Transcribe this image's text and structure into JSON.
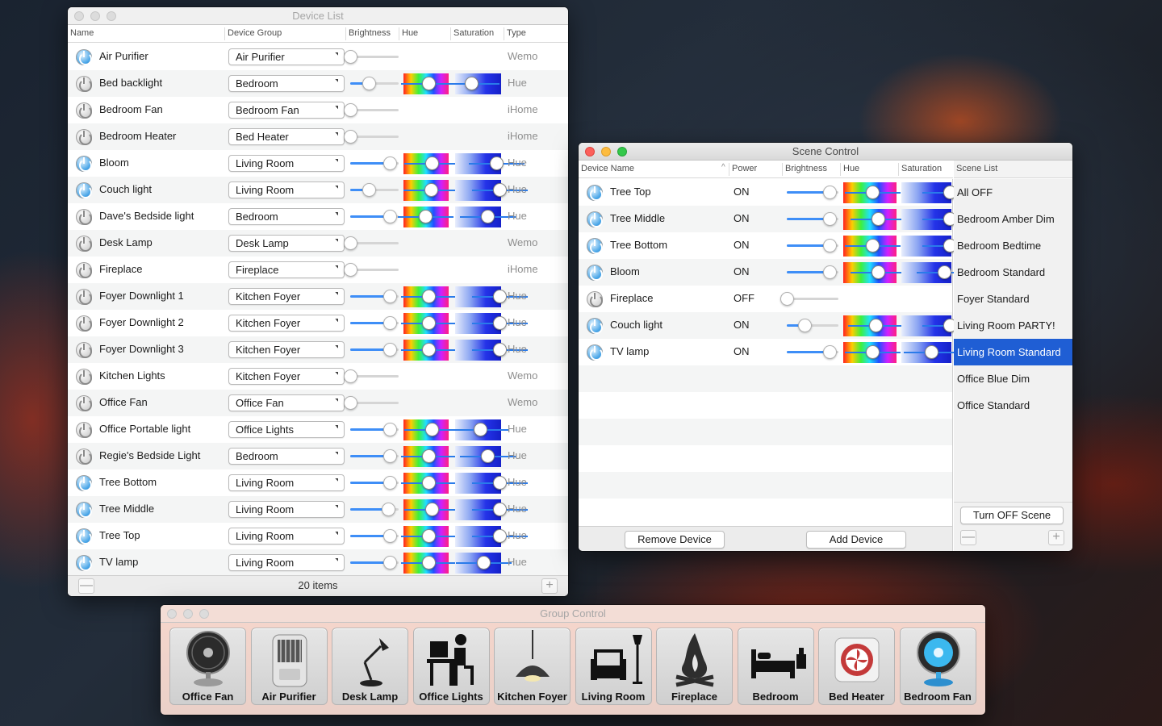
{
  "device_list": {
    "title": "Device List",
    "columns": {
      "name": "Name",
      "group": "Device Group",
      "brightness": "Brightness",
      "hue": "Hue",
      "saturation": "Saturation",
      "type": "Type"
    },
    "footer_count": "20 items",
    "remove_symbol": "—",
    "add_symbol": "+",
    "rows": [
      {
        "name": "Air Purifier",
        "group": "Air Purifier",
        "type": "Wemo",
        "on": true,
        "brightness": 0,
        "hue": null,
        "sat": null
      },
      {
        "name": "Bed backlight",
        "group": "Bedroom",
        "type": "Hue",
        "on": false,
        "brightness": 0.45,
        "hue": 0.55,
        "sat": 0.35
      },
      {
        "name": "Bedroom Fan",
        "group": "Bedroom Fan",
        "type": "iHome",
        "on": false,
        "brightness": 0,
        "hue": null,
        "sat": null
      },
      {
        "name": "Bedroom Heater",
        "group": "Bed Heater",
        "type": "iHome",
        "on": false,
        "brightness": 0,
        "hue": null,
        "sat": null
      },
      {
        "name": "Bloom",
        "group": "Living Room",
        "type": "Hue",
        "on": true,
        "brightness": 0.95,
        "hue": 0.62,
        "sat": 0.9
      },
      {
        "name": "Couch light",
        "group": "Living Room",
        "type": "Hue",
        "on": true,
        "brightness": 0.45,
        "hue": 0.6,
        "sat": 0.97
      },
      {
        "name": "Dave's Bedside light",
        "group": "Bedroom",
        "type": "Hue",
        "on": false,
        "brightness": 0.95,
        "hue": 0.48,
        "sat": 0.7
      },
      {
        "name": "Desk Lamp",
        "group": "Desk Lamp",
        "type": "Wemo",
        "on": false,
        "brightness": 0,
        "hue": null,
        "sat": null
      },
      {
        "name": "Fireplace",
        "group": "Fireplace",
        "type": "iHome",
        "on": false,
        "brightness": 0,
        "hue": null,
        "sat": null
      },
      {
        "name": "Foyer Downlight 1",
        "group": "Kitchen Foyer",
        "type": "Hue",
        "on": false,
        "brightness": 0.95,
        "hue": 0.55,
        "sat": 0.97
      },
      {
        "name": "Foyer Downlight 2",
        "group": "Kitchen Foyer",
        "type": "Hue",
        "on": false,
        "brightness": 0.95,
        "hue": 0.55,
        "sat": 0.97
      },
      {
        "name": "Foyer Downlight 3",
        "group": "Kitchen Foyer",
        "type": "Hue",
        "on": false,
        "brightness": 0.95,
        "hue": 0.55,
        "sat": 0.97
      },
      {
        "name": "Kitchen Lights",
        "group": "Kitchen Foyer",
        "type": "Wemo",
        "on": false,
        "brightness": 0,
        "hue": null,
        "sat": null
      },
      {
        "name": "Office Fan",
        "group": "Office Fan",
        "type": "Wemo",
        "on": false,
        "brightness": 0,
        "hue": null,
        "sat": null
      },
      {
        "name": "Office Portable light",
        "group": "Office Lights",
        "type": "Hue",
        "on": false,
        "brightness": 0.95,
        "hue": 0.62,
        "sat": 0.55
      },
      {
        "name": "Regie's Bedside Light",
        "group": "Bedroom",
        "type": "Hue",
        "on": false,
        "brightness": 0.95,
        "hue": 0.55,
        "sat": 0.7
      },
      {
        "name": "Tree Bottom",
        "group": "Living Room",
        "type": "Hue",
        "on": true,
        "brightness": 0.95,
        "hue": 0.55,
        "sat": 0.97
      },
      {
        "name": "Tree Middle",
        "group": "Living Room",
        "type": "Hue",
        "on": true,
        "brightness": 0.9,
        "hue": 0.62,
        "sat": 0.97
      },
      {
        "name": "Tree Top",
        "group": "Living Room",
        "type": "Hue",
        "on": true,
        "brightness": 0.95,
        "hue": 0.55,
        "sat": 0.97
      },
      {
        "name": "TV lamp",
        "group": "Living Room",
        "type": "Hue",
        "on": true,
        "brightness": 0.95,
        "hue": 0.55,
        "sat": 0.62
      }
    ]
  },
  "scene_control": {
    "title": "Scene Control",
    "columns": {
      "device_name": "Device Name",
      "sort_indicator": "^",
      "power": "Power",
      "brightness": "Brightness",
      "hue": "Hue",
      "saturation": "Saturation",
      "scene_list": "Scene List"
    },
    "devices": [
      {
        "name": "Tree Top",
        "power": "ON",
        "on": true,
        "brightness": 0.95,
        "hue": 0.55,
        "sat": 0.97
      },
      {
        "name": "Tree Middle",
        "power": "ON",
        "on": true,
        "brightness": 0.95,
        "hue": 0.65,
        "sat": 0.97
      },
      {
        "name": "Tree Bottom",
        "power": "ON",
        "on": true,
        "brightness": 0.95,
        "hue": 0.55,
        "sat": 0.97
      },
      {
        "name": "Bloom",
        "power": "ON",
        "on": true,
        "brightness": 0.95,
        "hue": 0.65,
        "sat": 0.85
      },
      {
        "name": "Fireplace",
        "power": "OFF",
        "on": false,
        "brightness": 0,
        "hue": null,
        "sat": null
      },
      {
        "name": "Couch light",
        "power": "ON",
        "on": true,
        "brightness": 0.4,
        "hue": 0.6,
        "sat": 0.97
      },
      {
        "name": "TV lamp",
        "power": "ON",
        "on": true,
        "brightness": 0.95,
        "hue": 0.55,
        "sat": 0.6
      }
    ],
    "scenes": [
      "All OFF",
      "Bedroom Amber Dim",
      "Bedroom Bedtime",
      "Bedroom Standard",
      "Foyer Standard",
      "Living Room PARTY!",
      "Living Room Standard",
      "Office Blue Dim",
      "Office Standard"
    ],
    "selected_scene": "Living Room Standard",
    "remove_device_label": "Remove Device",
    "add_device_label": "Add Device",
    "turn_off_scene_label": "Turn OFF Scene",
    "remove_symbol": "—",
    "add_symbol": "+"
  },
  "group_control": {
    "title": "Group Control",
    "groups": [
      {
        "label": "Office Fan",
        "icon": "desk-fan-icon"
      },
      {
        "label": "Air Purifier",
        "icon": "air-purifier-icon"
      },
      {
        "label": "Desk Lamp",
        "icon": "desk-lamp-icon"
      },
      {
        "label": "Office Lights",
        "icon": "office-worker-icon"
      },
      {
        "label": "Kitchen Foyer",
        "icon": "pendant-lamp-icon"
      },
      {
        "label": "Living Room",
        "icon": "armchair-lamp-icon"
      },
      {
        "label": "Fireplace",
        "icon": "campfire-icon"
      },
      {
        "label": "Bedroom",
        "icon": "bed-icon"
      },
      {
        "label": "Bed Heater",
        "icon": "heater-icon"
      },
      {
        "label": "Bedroom Fan",
        "icon": "blue-fan-icon"
      }
    ]
  },
  "colors": {
    "accent": "#3e8ef7",
    "selection": "#1f5ed4",
    "power_on": "#4aa6e8"
  }
}
